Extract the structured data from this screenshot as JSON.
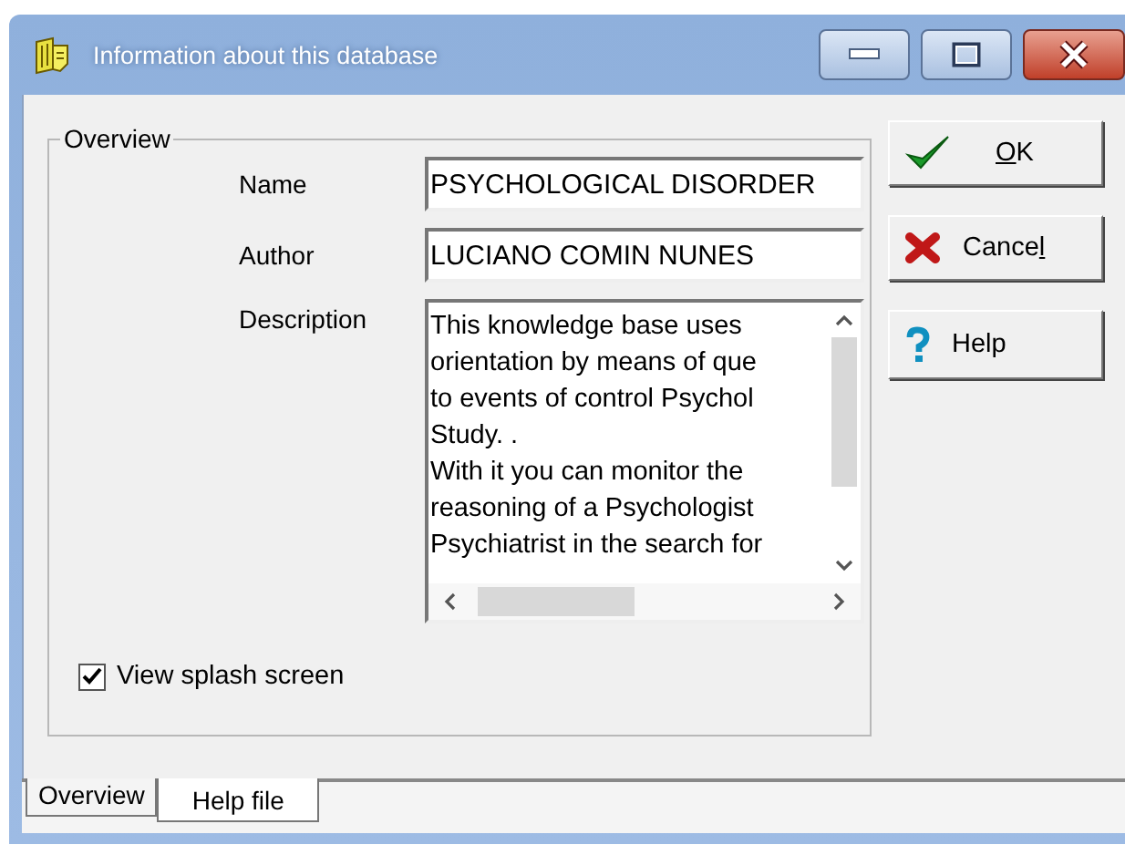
{
  "window": {
    "title": "Information about this database"
  },
  "overview": {
    "title": "Overview",
    "fields": [
      {
        "kind": "line",
        "label": "Name",
        "value": "PSYCHOLOGICAL DISORDER"
      },
      {
        "kind": "line",
        "label": "Author",
        "value": "LUCIANO COMIN NUNES"
      },
      {
        "kind": "memo",
        "label": "Description",
        "lines": [
          "This knowledge base uses",
          "orientation by means of que",
          "to events of control Psychol",
          "Study. .",
          "With it you can monitor the",
          "reasoning of a Psychologist",
          "Psychiatrist in the search for"
        ]
      }
    ],
    "checkbox": {
      "label": "View splash screen",
      "checked": true
    }
  },
  "buttons": [
    {
      "kind": "ok",
      "label": [
        {
          "text": "O",
          "underlined": true
        },
        {
          "text": "K",
          "underlined": false
        }
      ]
    },
    {
      "kind": "cancel",
      "label": [
        {
          "text": "Cance",
          "underlined": false
        },
        {
          "text": "l",
          "underlined": true
        }
      ]
    },
    {
      "kind": "help",
      "label": [
        {
          "text": "Help",
          "underlined": false
        }
      ]
    }
  ],
  "tabs": [
    {
      "label": "Overview",
      "selected": true
    },
    {
      "label": "Help file",
      "selected": false
    }
  ]
}
